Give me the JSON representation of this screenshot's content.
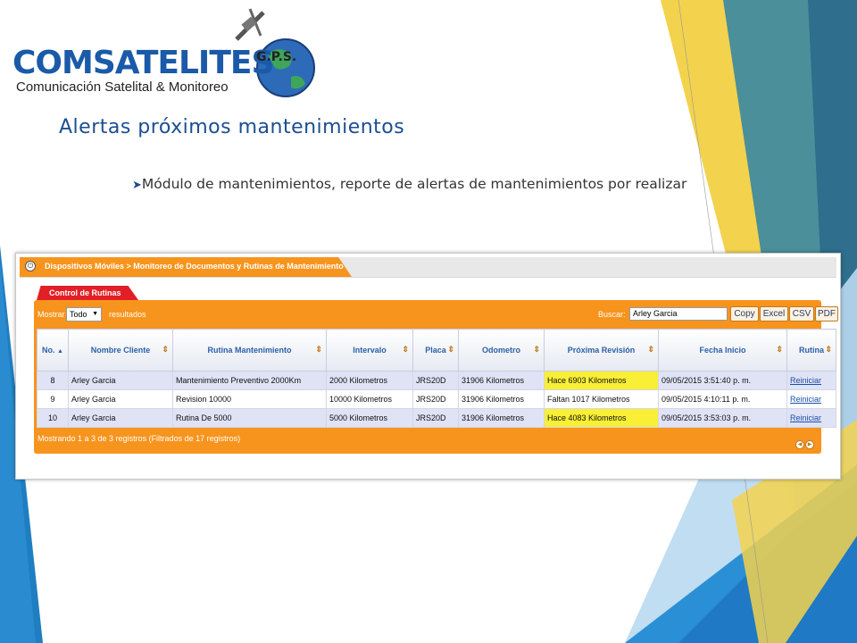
{
  "logo": {
    "brand": "COMSATELITES",
    "badge": "G.P.S.",
    "tagline": "Comunicación Satelital & Monitoreo"
  },
  "slide": {
    "title": "Alertas próximos mantenimientos",
    "bullet": "Módulo de mantenimientos, reporte de alertas de mantenimientos por realizar"
  },
  "app": {
    "breadcrumb": "Dispositivos Móviles > Monitoreo de Documentos y Rutinas de Mantenimiento",
    "tab_label": "Control de Rutinas",
    "show_label": "Mostrar",
    "show_value": "Todo",
    "results_label": "resultados",
    "search_label": "Buscar:",
    "search_value": "Arley Garcia",
    "buttons": {
      "copy": "Copy",
      "excel": "Excel",
      "csv": "CSV",
      "pdf": "PDF"
    },
    "columns": [
      "No.",
      "Nombre Cliente",
      "Rutina Mantenimiento",
      "Intervalo",
      "Placa",
      "Odometro",
      "Próxima Revisión",
      "Fecha Inicio",
      "Rutina"
    ],
    "rows": [
      {
        "no": "8",
        "cliente": "Arley Garcia",
        "rutina": "Mantenimiento Preventivo 2000Km",
        "intervalo": "2000 Kilometros",
        "placa": "JRS20D",
        "odometro": "31906 Kilometros",
        "revision": "Hace 6903 Kilometros",
        "fecha": "09/05/2015 3:51:40 p. m.",
        "accion": "Reiniciar"
      },
      {
        "no": "9",
        "cliente": "Arley Garcia",
        "rutina": "Revision 10000",
        "intervalo": "10000 Kilometros",
        "placa": "JRS20D",
        "odometro": "31906 Kilometros",
        "revision": "Faltan 1017 Kilometros",
        "fecha": "09/05/2015 4:10:11 p. m.",
        "accion": "Reiniciar"
      },
      {
        "no": "10",
        "cliente": "Arley Garcia",
        "rutina": "Rutina De 5000",
        "intervalo": "5000 Kilometros",
        "placa": "JRS20D",
        "odometro": "31906 Kilometros",
        "revision": "Hace 4083 Kilometros",
        "fecha": "09/05/2015 3:53:03 p. m.",
        "accion": "Reiniciar"
      }
    ],
    "footer": "Mostrando 1 a 3 de 3 registros (Filtrados de 17 registros)"
  },
  "colors": {
    "accent_orange": "#f7941d",
    "tab_red": "#e21f26",
    "alert_yellow": "#f8ef36",
    "title_blue": "#1b4e91"
  }
}
